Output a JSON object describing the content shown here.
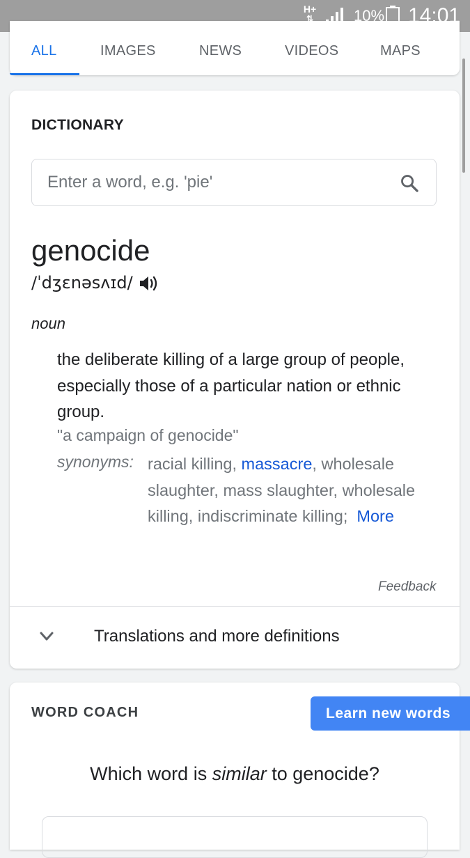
{
  "status_bar": {
    "network": "H+",
    "arrows": "⇅",
    "battery_percent": "10%",
    "time": "14:01"
  },
  "tabs": [
    {
      "label": "ALL",
      "active": true
    },
    {
      "label": "IMAGES",
      "active": false
    },
    {
      "label": "NEWS",
      "active": false
    },
    {
      "label": "VIDEOS",
      "active": false
    },
    {
      "label": "MAPS",
      "active": false
    }
  ],
  "dictionary": {
    "title": "DICTIONARY",
    "search_placeholder": "Enter a word, e.g. 'pie'",
    "search_icon": "search-icon",
    "word": "genocide",
    "phonetic": "/ˈdʒɛnəsʌɪd/",
    "speaker_icon": "speaker-icon",
    "part_of_speech": "noun",
    "definition": "the deliberate killing of a large group of people, especially those of a particular nation or ethnic group.",
    "example": "\"a campaign of genocide\"",
    "synonyms_label": "synonyms:",
    "synonyms": [
      {
        "text": "racial killing",
        "link": false
      },
      {
        "text": "massacre",
        "link": true
      },
      {
        "text": "wholesale slaughter",
        "link": false
      },
      {
        "text": "mass slaughter",
        "link": false
      },
      {
        "text": "wholesale killing",
        "link": false
      },
      {
        "text": "indiscriminate killing",
        "link": false
      }
    ],
    "more_link": "More",
    "feedback": "Feedback",
    "expand_label": "Translations and more definitions",
    "expand_icon": "chevron-down-icon"
  },
  "word_coach": {
    "title": "WORD COACH",
    "button_label": "Learn new words",
    "question_prefix": "Which word is ",
    "question_emphasis": "similar",
    "question_suffix": " to genocide?"
  },
  "colors": {
    "accent": "#1a73e8",
    "link": "#1558d6",
    "button": "#4285f4",
    "status_bar": "#9e9e9e"
  }
}
